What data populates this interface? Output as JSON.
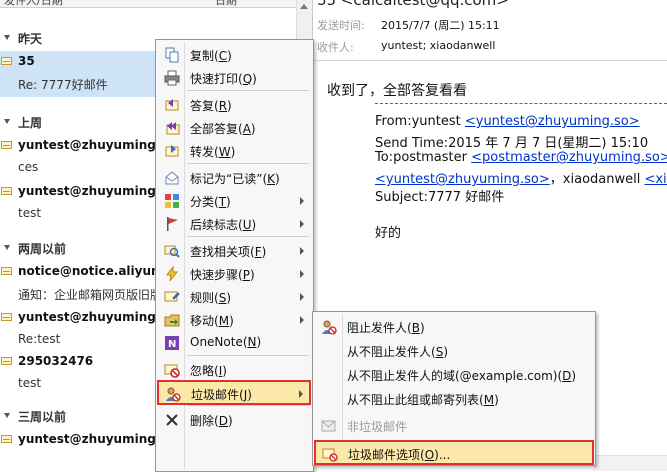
{
  "message_list": {
    "header_left": "发件人/日期",
    "header_right": "日期",
    "groups": [
      {
        "label": "昨天",
        "items": [
          {
            "sender": "35",
            "subject": "Re: 7777好邮件",
            "selected": true
          }
        ]
      },
      {
        "label": "上周",
        "items": [
          {
            "sender": "yuntest@zhuyuming.so",
            "subject": "ces"
          },
          {
            "sender": "yuntest@zhuyuming.so",
            "subject": "test"
          }
        ]
      },
      {
        "label": "两周以前",
        "items": [
          {
            "sender": "notice@notice.aliyun.com",
            "subject": "通知：企业邮箱网页版旧版"
          },
          {
            "sender": "yuntest@zhuyuming.so",
            "subject": "Re:test"
          },
          {
            "sender": "295032476",
            "subject": "test"
          }
        ]
      },
      {
        "label": "三周以前",
        "items": [
          {
            "sender": "yuntest@zhuyuming.so",
            "subject": ""
          }
        ]
      }
    ]
  },
  "reading": {
    "subject": "35 <calcaltest@qq.com>",
    "sent_label": "发送时间:",
    "sent_value": "2015/7/7 (周二) 15:11",
    "to_label": "收件人:",
    "to_value": "yuntest; xiaodanwell",
    "body_first": "收到了，全部答复看看",
    "quote": {
      "from_prefix": "From:yuntest ",
      "from_link": "<yuntest@zhuyuming.so>",
      "send_time": "Send Time:2015 年 7 月 7 日(星期二) 15:10",
      "to_prefix": "To:postmaster ",
      "to_link": "<postmaster@zhuyuming.so>",
      "to_suffix": ",",
      "cc_link": "<yuntest@zhuyuming.so>",
      "cc_mid": "，xiaodanwell ",
      "cc_link2": "<xiao",
      "subject": "Subject:7777 好邮件",
      "greeting": "好的"
    }
  },
  "context_menu": {
    "items": [
      {
        "label": "复制",
        "key": "C",
        "icon": "copy-icon"
      },
      {
        "label": "快速打印",
        "key": "Q",
        "icon": "print-icon"
      },
      {
        "sep": true
      },
      {
        "label": "答复",
        "key": "R",
        "icon": "reply-icon"
      },
      {
        "label": "全部答复",
        "key": "A",
        "icon": "reply-all-icon"
      },
      {
        "label": "转发",
        "key": "W",
        "icon": "forward-icon"
      },
      {
        "sep": true
      },
      {
        "label": "标记为“已读”",
        "key": "K",
        "icon": "mark-read-icon"
      },
      {
        "label": "分类",
        "key": "T",
        "icon": "categorize-icon",
        "arrow": true
      },
      {
        "label": "后续标志",
        "key": "U",
        "icon": "flag-icon",
        "arrow": true
      },
      {
        "sep": true
      },
      {
        "label": "查找相关项",
        "key": "F",
        "icon": "find-related-icon",
        "arrow": true
      },
      {
        "label": "快速步骤",
        "key": "P",
        "icon": "quick-steps-icon",
        "arrow": true
      },
      {
        "label": "规则",
        "key": "S",
        "icon": "rules-icon",
        "arrow": true
      },
      {
        "label": "移动",
        "key": "M",
        "icon": "move-icon",
        "arrow": true
      },
      {
        "label": "OneNote",
        "key": "N",
        "icon": "onenote-icon",
        "label_prefix": "OneNote"
      },
      {
        "sep": true
      },
      {
        "label": "忽略",
        "key": "I",
        "icon": "ignore-icon"
      },
      {
        "label": "垃圾邮件",
        "key": "J",
        "icon": "junk-icon",
        "arrow": true,
        "highlight": true
      },
      {
        "sep": true
      },
      {
        "label": "删除",
        "key": "D",
        "icon": "delete-icon"
      }
    ]
  },
  "junk_submenu": {
    "items": [
      {
        "label": "阻止发件人",
        "key": "B",
        "icon": "block-sender-icon"
      },
      {
        "label": "从不阻止发件人",
        "key": "S"
      },
      {
        "label": "从不阻止发件人的域(@example.com)",
        "key": "D"
      },
      {
        "label": "从不阻止此组或邮寄列表",
        "key": "M"
      },
      {
        "label": "非垃圾邮件",
        "key": "",
        "disabled": true,
        "icon": "not-junk-icon"
      },
      {
        "label": "垃圾邮件选项",
        "key": "O",
        "suffix": "...",
        "icon": "junk-options-icon",
        "highlight": true
      }
    ]
  }
}
